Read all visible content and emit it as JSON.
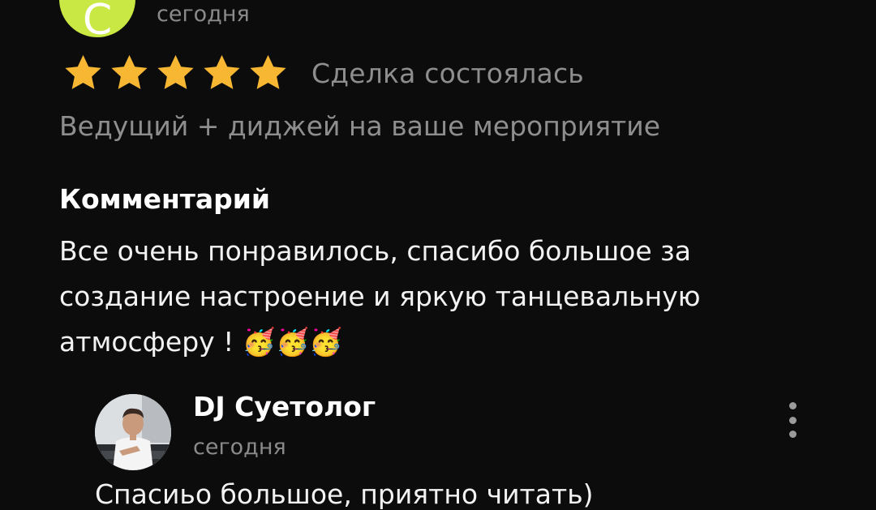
{
  "review": {
    "avatar_letter": "C",
    "avatar_color": "#c9e843",
    "date": "сегодня",
    "rating": 5,
    "rating_max": 5,
    "star_color": "#f7b733",
    "status": "Сделка состоялась",
    "service": "Ведущий + диджей на ваше мероприятие",
    "comment_label": "Комментарий",
    "comment": "Все очень понравилось, спасибо большое за создание настроение и яркую танцевальную атмосферу ! 🥳🥳🥳"
  },
  "reply": {
    "author": "DJ Суетолог",
    "date": "сегодня",
    "text": "Спасиьо большое, приятно читать)",
    "menu_icon": "more-vertical-icon"
  }
}
